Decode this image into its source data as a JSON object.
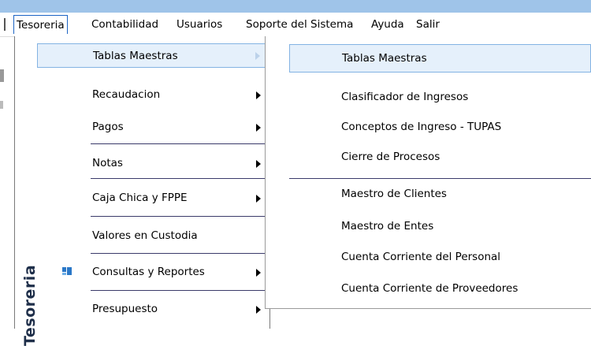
{
  "menubar": {
    "items": [
      {
        "label": "Tesoreria",
        "active": true
      },
      {
        "label": "Contabilidad"
      },
      {
        "label": "Usuarios"
      },
      {
        "label": "Soporte del Sistema"
      },
      {
        "label": "Ayuda"
      },
      {
        "label": "Salir"
      }
    ]
  },
  "tesoreria_menu": {
    "side_label": "Tesoreria",
    "items": [
      {
        "label": "Tablas Maestras",
        "submenu": true,
        "highlighted": true
      },
      {
        "label": "Recaudacion",
        "submenu": true
      },
      {
        "label": "Pagos",
        "submenu": true
      },
      {
        "label": "Notas",
        "submenu": true
      },
      {
        "label": "Caja Chica y FPPE",
        "submenu": true
      },
      {
        "label": "Valores en Custodia",
        "submenu": false,
        "icon": "custody-icon"
      },
      {
        "label": "Consultas y Reportes",
        "submenu": true
      },
      {
        "label": "Presupuesto",
        "submenu": true
      }
    ]
  },
  "tablas_maestras_submenu": {
    "items": [
      {
        "label": "Tablas Maestras",
        "highlighted": true
      },
      {
        "label": "Clasificador de Ingresos"
      },
      {
        "label": "Conceptos de Ingreso - TUPAS"
      },
      {
        "label": "Cierre de Procesos"
      },
      {
        "label": "Maestro de Clientes"
      },
      {
        "label": "Maestro de Entes"
      },
      {
        "label": "Cuenta Corriente del Personal"
      },
      {
        "label": "Cuenta Corriente de Proveedores"
      }
    ]
  },
  "colors": {
    "titlebar": "#9fc4e9",
    "highlight_fill": "#e5f0fb",
    "highlight_border": "#83b3e3",
    "active_menu_border": "#1c64c4",
    "side_label_text": "#1f2f4a"
  }
}
